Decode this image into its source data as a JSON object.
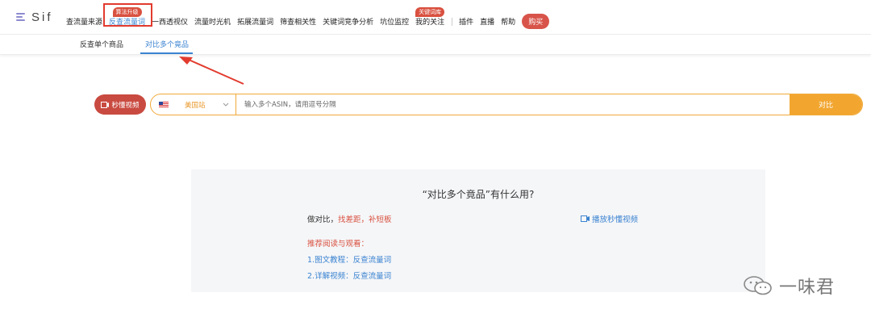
{
  "logo": {
    "text": "Sif"
  },
  "nav": {
    "items": [
      {
        "label": "查流量来源"
      },
      {
        "label": "反查流量词",
        "tag": "算法升级"
      },
      {
        "label": "一西透视仪"
      },
      {
        "label": "流量时光机"
      },
      {
        "label": "拓展流量词"
      },
      {
        "label": "筛查相关性"
      },
      {
        "label": "关键词竞争分析"
      },
      {
        "label": "坑位监控"
      },
      {
        "label": "我的关注",
        "tag": "关键词库"
      },
      {
        "label": "插件"
      },
      {
        "label": "直播"
      },
      {
        "label": "帮助"
      }
    ],
    "buy_label": "购买"
  },
  "subtabs": {
    "single": "反查单个商品",
    "multiple": "对比多个竟品"
  },
  "search": {
    "video_button": "秒懂视频",
    "site": "美国站",
    "placeholder": "输入多个ASIN，请用逗号分隔",
    "compare_button": "对比"
  },
  "info": {
    "title": "“对比多个竟品”有什么用?",
    "line_prefix": "做对比，",
    "line_highlight": "找差距，补短板",
    "play_video": "播放秒懂视频",
    "recommend_title": "推荐阅读与观看：",
    "links": [
      "1.图文教程：反查流量词",
      "2.详解视频：反查流量词"
    ]
  },
  "watermark": {
    "text": "一味君"
  },
  "colors": {
    "accent": "#3a83d1",
    "brand_red": "#d9503f",
    "orange": "#f2a630"
  }
}
